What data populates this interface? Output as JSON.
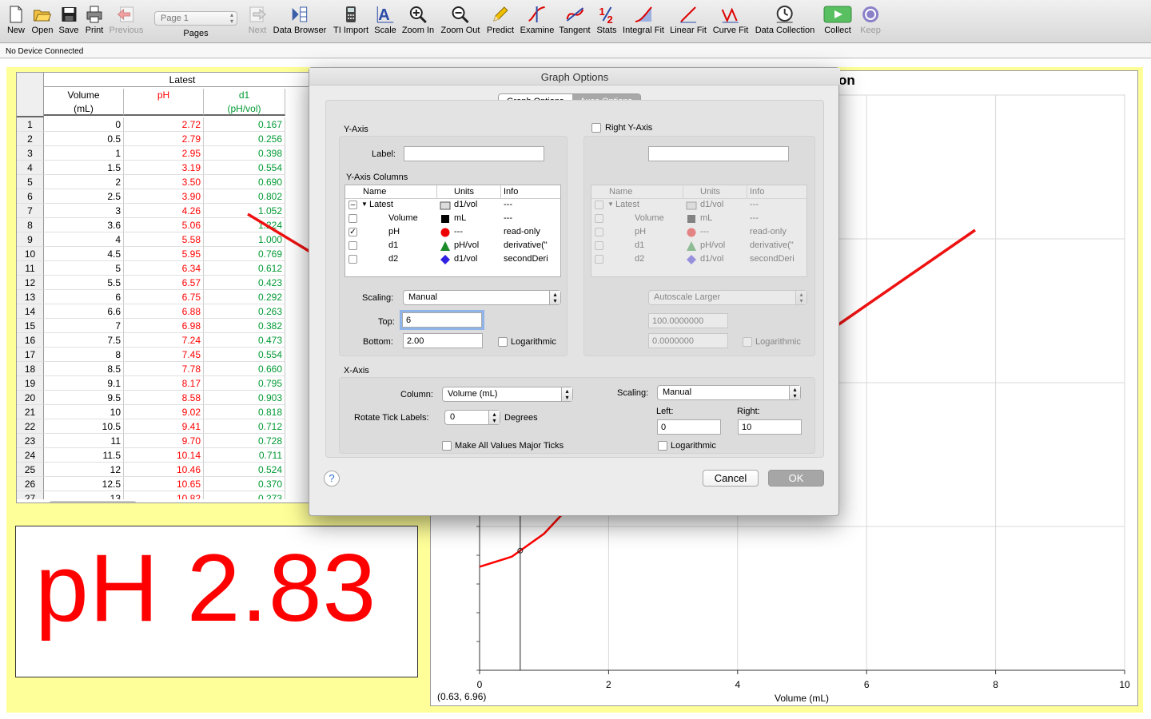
{
  "toolbar": {
    "items": [
      {
        "label": "New",
        "icon": "new-document-icon"
      },
      {
        "label": "Open",
        "icon": "open-folder-icon"
      },
      {
        "label": "Save",
        "icon": "save-disk-icon"
      },
      {
        "label": "Print",
        "icon": "printer-icon"
      },
      {
        "label": "Previous",
        "icon": "previous-arrow-icon"
      },
      {
        "label": "Pages",
        "icon": ""
      },
      {
        "label": "Next",
        "icon": "next-arrow-icon"
      },
      {
        "label": "Data Browser",
        "icon": "data-browser-icon"
      },
      {
        "label": "TI Import",
        "icon": "calculator-icon"
      },
      {
        "label": "Scale",
        "icon": "scale-icon"
      },
      {
        "label": "Zoom In",
        "icon": "zoom-in-icon"
      },
      {
        "label": "Zoom Out",
        "icon": "zoom-out-icon"
      },
      {
        "label": "Predict",
        "icon": "pencil-icon"
      },
      {
        "label": "Examine",
        "icon": "examine-icon"
      },
      {
        "label": "Tangent",
        "icon": "tangent-icon"
      },
      {
        "label": "Stats",
        "icon": "stats-icon"
      },
      {
        "label": "Integral Fit",
        "icon": "integral-icon"
      },
      {
        "label": "Linear Fit",
        "icon": "linear-fit-icon"
      },
      {
        "label": "Curve Fit",
        "icon": "curve-fit-icon"
      },
      {
        "label": "Data Collection",
        "icon": "clock-icon"
      },
      {
        "label": "Collect",
        "icon": "play-icon"
      },
      {
        "label": "Keep",
        "icon": "keep-icon"
      }
    ],
    "page_select": "Page 1"
  },
  "status": "No Device Connected",
  "table": {
    "group_header": "Latest",
    "columns": [
      {
        "name": "Volume",
        "unit": "(mL)",
        "color": "#000000"
      },
      {
        "name": "pH",
        "unit": "",
        "color": "#ff0000"
      },
      {
        "name": "d1",
        "unit": "(pH/vol)",
        "color": "#009933"
      }
    ],
    "rows": [
      [
        "1",
        "0",
        "2.72",
        "0.167"
      ],
      [
        "2",
        "0.5",
        "2.79",
        "0.256"
      ],
      [
        "3",
        "1",
        "2.95",
        "0.398"
      ],
      [
        "4",
        "1.5",
        "3.19",
        "0.554"
      ],
      [
        "5",
        "2",
        "3.50",
        "0.690"
      ],
      [
        "6",
        "2.5",
        "3.90",
        "0.802"
      ],
      [
        "7",
        "3",
        "4.26",
        "1.052"
      ],
      [
        "8",
        "3.6",
        "5.06",
        "1.224"
      ],
      [
        "9",
        "4",
        "5.58",
        "1.000"
      ],
      [
        "10",
        "4.5",
        "5.95",
        "0.769"
      ],
      [
        "11",
        "5",
        "6.34",
        "0.612"
      ],
      [
        "12",
        "5.5",
        "6.57",
        "0.423"
      ],
      [
        "13",
        "6",
        "6.75",
        "0.292"
      ],
      [
        "14",
        "6.6",
        "6.88",
        "0.263"
      ],
      [
        "15",
        "7",
        "6.98",
        "0.382"
      ],
      [
        "16",
        "7.5",
        "7.24",
        "0.473"
      ],
      [
        "17",
        "8",
        "7.45",
        "0.554"
      ],
      [
        "18",
        "8.5",
        "7.78",
        "0.660"
      ],
      [
        "19",
        "9.1",
        "8.17",
        "0.795"
      ],
      [
        "20",
        "9.5",
        "8.58",
        "0.903"
      ],
      [
        "21",
        "10",
        "9.02",
        "0.818"
      ],
      [
        "22",
        "10.5",
        "9.41",
        "0.712"
      ],
      [
        "23",
        "11",
        "9.70",
        "0.728"
      ],
      [
        "24",
        "11.5",
        "10.14",
        "0.711"
      ],
      [
        "25",
        "12",
        "10.46",
        "0.524"
      ],
      [
        "26",
        "12.5",
        "10.65",
        "0.370"
      ],
      [
        "27",
        "13",
        "10.82",
        "0.273"
      ]
    ]
  },
  "meter": {
    "text": "pH 2.83",
    "color": "#ff0000"
  },
  "graph": {
    "title_fragment": "on",
    "xlabel": "Volume (mL)",
    "readout": "(0.63, 6.96)",
    "x_ticks": [
      "0",
      "2",
      "4",
      "6",
      "8",
      "10"
    ]
  },
  "chart_data": {
    "type": "line",
    "title": "",
    "xlabel": "Volume (mL)",
    "ylabel": "",
    "xlim": [
      0,
      10
    ],
    "ylim": [
      2,
      6
    ],
    "grid": true,
    "x": [
      0,
      0.5,
      1,
      1.5,
      2,
      2.5,
      3,
      3.6,
      4,
      4.5,
      5,
      5.5,
      6,
      6.6,
      7,
      7.5,
      8,
      8.5,
      9.1,
      9.5,
      10
    ],
    "series": [
      {
        "name": "pH",
        "color": "#ff0000",
        "values": [
          2.72,
          2.79,
          2.95,
          3.19,
          3.5,
          3.9,
          4.26,
          5.06,
          5.58,
          5.95,
          6.34,
          6.57,
          6.75,
          6.88,
          6.98,
          7.24,
          7.45,
          7.78,
          8.17,
          8.58,
          9.02
        ]
      }
    ],
    "x_ticks": [
      0,
      2,
      4,
      6,
      8,
      10
    ],
    "examine_x": 0.63
  },
  "dialog": {
    "title": "Graph Options",
    "tabs": [
      "Graph Options",
      "Axes Options"
    ],
    "y_axis": {
      "header": "Y-Axis",
      "label_caption": "Label:",
      "label_value": "",
      "columns_header": "Y-Axis Columns",
      "col_headers": [
        "Name",
        "Units",
        "Info"
      ],
      "rows": [
        {
          "name": "Latest",
          "units": "d1/vol",
          "info": "---",
          "checked": "–",
          "mark": "table"
        },
        {
          "name": "Volume",
          "units": "mL",
          "info": "---",
          "checked": "",
          "mark": "square"
        },
        {
          "name": "pH",
          "units": "---",
          "info": "read-only",
          "checked": "✓",
          "mark": "circle"
        },
        {
          "name": "d1",
          "units": "pH/vol",
          "info": "derivative(\"",
          "checked": "",
          "mark": "triangle"
        },
        {
          "name": "d2",
          "units": "d1/vol",
          "info": "secondDeri",
          "checked": "",
          "mark": "diamond"
        }
      ],
      "scaling_caption": "Scaling:",
      "scaling_value": "Manual",
      "top_caption": "Top:",
      "top_value": "6",
      "bottom_caption": "Bottom:",
      "bottom_value": "2.00",
      "log_caption": "Logarithmic"
    },
    "right_y_axis": {
      "header": "Right Y-Axis",
      "label_value": "",
      "col_headers": [
        "Name",
        "Units",
        "Info"
      ],
      "rows": [
        {
          "name": "Latest",
          "units": "d1/vol",
          "info": "---",
          "mark": "table"
        },
        {
          "name": "Volume",
          "units": "mL",
          "info": "---",
          "mark": "square"
        },
        {
          "name": "pH",
          "units": "---",
          "info": "read-only",
          "mark": "circle"
        },
        {
          "name": "d1",
          "units": "pH/vol",
          "info": "derivative(\"",
          "mark": "triangle"
        },
        {
          "name": "d2",
          "units": "d1/vol",
          "info": "secondDeri",
          "mark": "diamond"
        }
      ],
      "scaling_value": "Autoscale Larger",
      "top_value": "100.0000000",
      "bottom_value": "0.0000000",
      "log_caption": "Logarithmic"
    },
    "x_axis": {
      "header": "X-Axis",
      "column_caption": "Column:",
      "column_value": "Volume (mL)",
      "rotate_caption": "Rotate Tick Labels:",
      "rotate_value": "0",
      "degrees_caption": "Degrees",
      "major_ticks_caption": "Make All Values Major Ticks",
      "scaling_caption": "Scaling:",
      "scaling_value": "Manual",
      "left_caption": "Left:",
      "left_value": "0",
      "right_caption": "Right:",
      "right_value": "10",
      "log_caption": "Logarithmic"
    },
    "help": "?",
    "cancel": "Cancel",
    "ok": "OK"
  },
  "colors": {
    "arrow": "#ee1111",
    "page_bg": "#ffff99",
    "curve": "#ff0000"
  }
}
